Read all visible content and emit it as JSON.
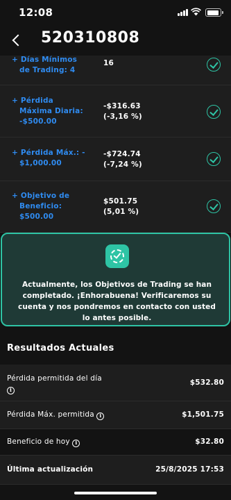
{
  "status_bar": {
    "time": "12:08"
  },
  "header": {
    "title": "520310808"
  },
  "objectives": [
    {
      "label_lines": [
        "+ Días Mínimos",
        "de Trading:  4"
      ],
      "value_lines": [
        "16",
        ""
      ],
      "status": "completed"
    },
    {
      "label_lines": [
        "+ Pérdida",
        "Máxima Diaria:",
        "-$500.00"
      ],
      "value_lines": [
        "-$316.63",
        "(-3,16 %)"
      ],
      "status": "completed"
    },
    {
      "label_lines": [
        "+ Pérdida Máx.: -",
        "$1,000.00"
      ],
      "value_lines": [
        "-$724.74",
        "(-7,24 %)"
      ],
      "status": "completed"
    },
    {
      "label_lines": [
        "+  Objetivo de",
        "Beneficio:",
        "$500.00"
      ],
      "value_lines": [
        "$501.75",
        "(5,01 %)"
      ],
      "status": "completed"
    }
  ],
  "completion": {
    "message": "Actualmente, los Objetivos de Trading se han completado. ¡Enhorabuena! Verificaremos su cuenta y nos pondremos en contacto con usted lo antes posible."
  },
  "results": {
    "title": "Resultados Actuales",
    "rows": [
      {
        "label": "Pérdida permitida del día",
        "value": "$532.80",
        "info": true
      },
      {
        "label": "Pérdida Máx. permitida",
        "value": "$1,501.75",
        "info": true
      },
      {
        "label": "Beneficio de hoy",
        "value": "$32.80",
        "info": true
      },
      {
        "label": "Última actualización",
        "value": "25/8/2025 17:53",
        "info": false
      }
    ]
  },
  "colors": {
    "background": "#131313",
    "row_background": "#1e1e1e",
    "accent_blue": "#2f8bf0",
    "accent_teal": "#2ec4a5",
    "card_background": "#1f3a36"
  },
  "icons": {
    "back": "chevron-left-icon",
    "check": "check-circle-icon",
    "badge": "verified-badge-icon",
    "info": "info-icon"
  }
}
